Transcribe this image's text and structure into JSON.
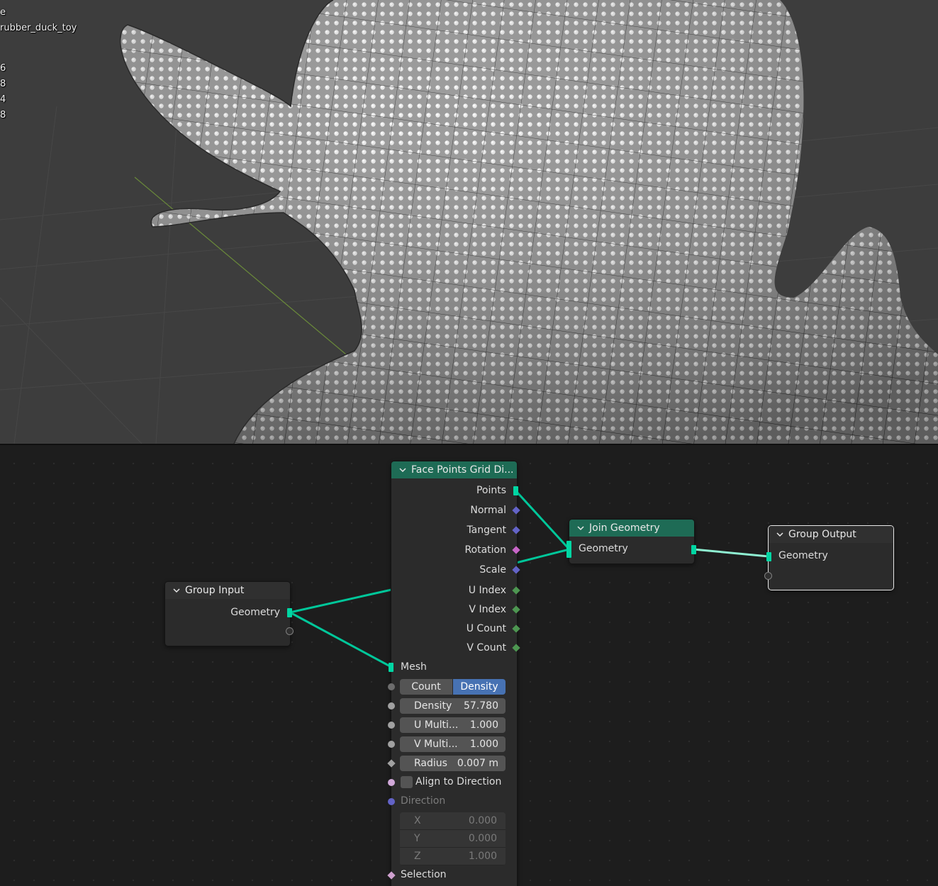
{
  "viewport": {
    "overlay_lines": [
      "e",
      "rubber_duck_toy",
      "",
      "6",
      "8",
      "4",
      "8"
    ]
  },
  "nodes": {
    "face_points": {
      "title": "Face Points Grid Di...",
      "outputs": [
        "Points",
        "Normal",
        "Tangent",
        "Rotation",
        "Scale",
        "U Index",
        "V Index",
        "U Count",
        "V Count"
      ],
      "mesh_label": "Mesh",
      "mode_options": [
        "Count",
        "Density"
      ],
      "mode_selected": "Density",
      "density": {
        "label": "Density",
        "value": "57.780"
      },
      "u_multi": {
        "label": "U Multi...",
        "value": "1.000"
      },
      "v_multi": {
        "label": "V Multi...",
        "value": "1.000"
      },
      "radius": {
        "label": "Radius",
        "value": "0.007 m"
      },
      "align_label": "Align to Direction",
      "direction_label": "Direction",
      "direction": [
        {
          "axis": "X",
          "value": "0.000"
        },
        {
          "axis": "Y",
          "value": "0.000"
        },
        {
          "axis": "Z",
          "value": "1.000"
        }
      ],
      "selection_label": "Selection"
    },
    "join_geometry": {
      "title": "Join Geometry",
      "input": "Geometry"
    },
    "group_input": {
      "title": "Group Input",
      "output": "Geometry"
    },
    "group_output": {
      "title": "Group Output",
      "input": "Geometry"
    }
  },
  "colors": {
    "geometry_socket": "#00d6a3",
    "vector_socket": "#6363c7",
    "rotation_socket": "#c765c7",
    "int_socket": "#4d9651",
    "node_header_green": "#1e6b55",
    "toggle_active": "#4772b3"
  }
}
